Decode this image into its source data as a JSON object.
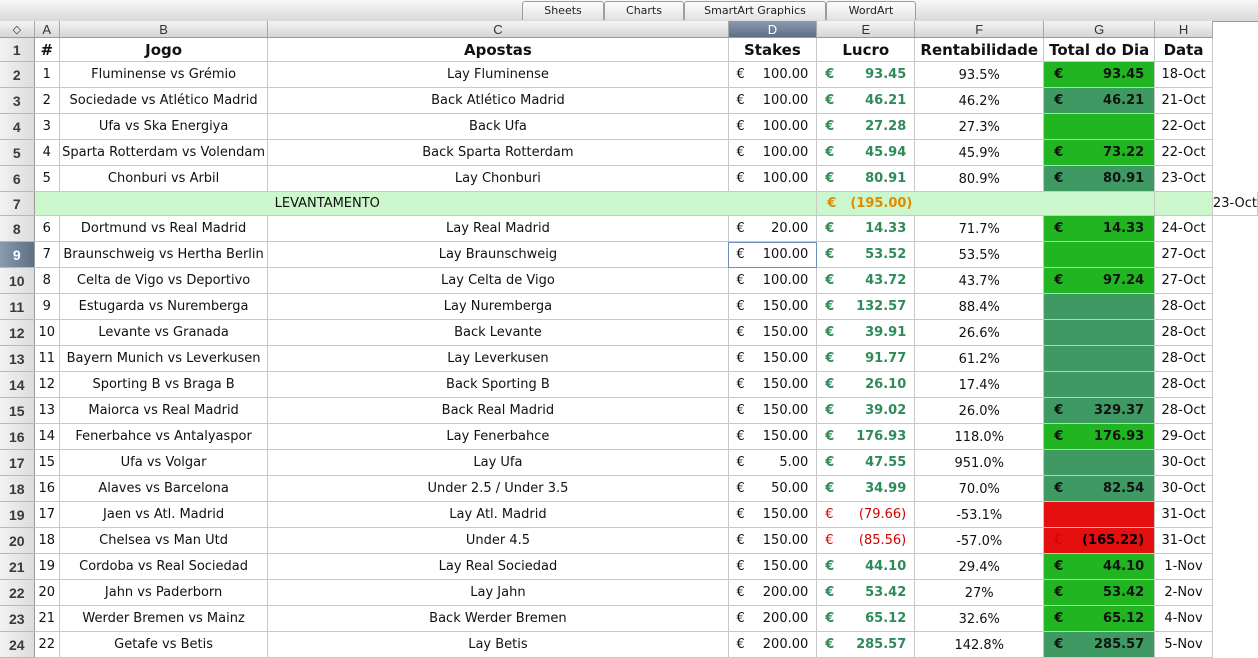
{
  "ribbon": {
    "tabs": [
      "Sheets",
      "Charts",
      "SmartArt Graphics",
      "WordArt"
    ]
  },
  "corner_glyph": "◇",
  "columns": [
    "A",
    "B",
    "C",
    "D",
    "E",
    "F",
    "G",
    "H"
  ],
  "selected_column": "D",
  "selected_row": 9,
  "currency": "€",
  "headers": {
    "num": "#",
    "jogo": "Jogo",
    "apostas": "Apostas",
    "stakes": "Stakes",
    "lucro": "Lucro",
    "rent": "Rentabilidade",
    "total": "Total do Dia",
    "data": "Data"
  },
  "levantamento": {
    "row": 7,
    "label": "LEVANTAMENTO",
    "value": "(195.00)",
    "date": "23-Oct"
  },
  "bets": [
    {
      "row": 2,
      "n": "1",
      "jogo": "Fluminense vs Grémio",
      "aposta": "Lay Fluminense",
      "stake": "100.00",
      "lucro": "93.45",
      "rent": "93.5%",
      "total": "93.45",
      "data": "18-Oct"
    },
    {
      "row": 3,
      "n": "2",
      "jogo": "Sociedade vs Atlético Madrid",
      "aposta": "Back Atlético Madrid",
      "stake": "100.00",
      "lucro": "46.21",
      "rent": "46.2%",
      "total": "46.21",
      "data": "21-Oct"
    },
    {
      "row": 4,
      "n": "3",
      "jogo": "Ufa vs Ska Energiya",
      "aposta": "Back Ufa",
      "stake": "100.00",
      "lucro": "27.28",
      "rent": "27.3%",
      "total": "",
      "data": "22-Oct"
    },
    {
      "row": 5,
      "n": "4",
      "jogo": "Sparta Rotterdam vs Volendam",
      "aposta": "Back Sparta Rotterdam",
      "stake": "100.00",
      "lucro": "45.94",
      "rent": "45.9%",
      "total": "73.22",
      "data": "22-Oct"
    },
    {
      "row": 6,
      "n": "5",
      "jogo": "Chonburi vs Arbil",
      "aposta": "Lay Chonburi",
      "stake": "100.00",
      "lucro": "80.91",
      "rent": "80.9%",
      "total": "80.91",
      "data": "23-Oct"
    },
    {
      "row": 8,
      "n": "6",
      "jogo": "Dortmund vs Real Madrid",
      "aposta": "Lay Real Madrid",
      "stake": "20.00",
      "lucro": "14.33",
      "rent": "71.7%",
      "total": "14.33",
      "data": "24-Oct"
    },
    {
      "row": 9,
      "n": "7",
      "jogo": "Braunschweig vs Hertha Berlin",
      "aposta": "Lay Braunschweig",
      "stake": "100.00",
      "lucro": "53.52",
      "rent": "53.5%",
      "total": "",
      "data": "27-Oct"
    },
    {
      "row": 10,
      "n": "8",
      "jogo": "Celta de Vigo vs Deportivo",
      "aposta": "Lay Celta de Vigo",
      "stake": "100.00",
      "lucro": "43.72",
      "rent": "43.7%",
      "total": "97.24",
      "data": "27-Oct"
    },
    {
      "row": 11,
      "n": "9",
      "jogo": "Estugarda vs Nuremberga",
      "aposta": "Lay Nuremberga",
      "stake": "150.00",
      "lucro": "132.57",
      "rent": "88.4%",
      "total": "",
      "data": "28-Oct"
    },
    {
      "row": 12,
      "n": "10",
      "jogo": "Levante vs Granada",
      "aposta": "Back Levante",
      "stake": "150.00",
      "lucro": "39.91",
      "rent": "26.6%",
      "total": "",
      "data": "28-Oct"
    },
    {
      "row": 13,
      "n": "11",
      "jogo": "Bayern Munich vs Leverkusen",
      "aposta": "Lay Leverkusen",
      "stake": "150.00",
      "lucro": "91.77",
      "rent": "61.2%",
      "total": "",
      "data": "28-Oct"
    },
    {
      "row": 14,
      "n": "12",
      "jogo": "Sporting B vs Braga B",
      "aposta": "Back Sporting B",
      "stake": "150.00",
      "lucro": "26.10",
      "rent": "17.4%",
      "total": "",
      "data": "28-Oct"
    },
    {
      "row": 15,
      "n": "13",
      "jogo": "Maiorca vs Real Madrid",
      "aposta": "Back Real Madrid",
      "stake": "150.00",
      "lucro": "39.02",
      "rent": "26.0%",
      "total": "329.37",
      "data": "28-Oct"
    },
    {
      "row": 16,
      "n": "14",
      "jogo": "Fenerbahce vs Antalyaspor",
      "aposta": "Lay Fenerbahce",
      "stake": "150.00",
      "lucro": "176.93",
      "rent": "118.0%",
      "total": "176.93",
      "data": "29-Oct"
    },
    {
      "row": 17,
      "n": "15",
      "jogo": "Ufa vs Volgar",
      "aposta": "Lay Ufa",
      "stake": "5.00",
      "lucro": "47.55",
      "rent": "951.0%",
      "total": "",
      "data": "30-Oct"
    },
    {
      "row": 18,
      "n": "16",
      "jogo": "Alaves vs Barcelona",
      "aposta": "Under 2.5 / Under 3.5",
      "stake": "50.00",
      "lucro": "34.99",
      "rent": "70.0%",
      "total": "82.54",
      "data": "30-Oct"
    },
    {
      "row": 19,
      "n": "17",
      "jogo": "Jaen vs Atl. Madrid",
      "aposta": "Lay Atl. Madrid",
      "stake": "150.00",
      "lucro": "(79.66)",
      "rent": "-53.1%",
      "total": "",
      "data": "31-Oct"
    },
    {
      "row": 20,
      "n": "18",
      "jogo": "Chelsea vs Man Utd",
      "aposta": "Under 4.5",
      "stake": "150.00",
      "lucro": "(85.56)",
      "rent": "-57.0%",
      "total": "(165.22)",
      "data": "31-Oct"
    },
    {
      "row": 21,
      "n": "19",
      "jogo": "Cordoba vs Real Sociedad",
      "aposta": "Lay Real Sociedad",
      "stake": "150.00",
      "lucro": "44.10",
      "rent": "29.4%",
      "total": "44.10",
      "data": "1-Nov"
    },
    {
      "row": 22,
      "n": "20",
      "jogo": "Jahn vs Paderborn",
      "aposta": "Lay Jahn",
      "stake": "200.00",
      "lucro": "53.42",
      "rent": "27%",
      "total": "53.42",
      "data": "2-Nov"
    },
    {
      "row": 23,
      "n": "21",
      "jogo": "Werder Bremen vs Mainz",
      "aposta": "Back Werder Bremen",
      "stake": "200.00",
      "lucro": "65.12",
      "rent": "32.6%",
      "total": "65.12",
      "data": "4-Nov"
    },
    {
      "row": 24,
      "n": "22",
      "jogo": "Getafe vs Betis",
      "aposta": "Lay Betis",
      "stake": "200.00",
      "lucro": "285.57",
      "rent": "142.8%",
      "total": "285.57",
      "data": "5-Nov"
    }
  ],
  "total_fill": {
    "2": "bright",
    "3": "dark",
    "4": "bright",
    "5": "bright",
    "6": "dark",
    "8": "bright",
    "9": "bright",
    "10": "bright",
    "11": "dark",
    "12": "dark",
    "13": "dark",
    "14": "dark",
    "15": "dark",
    "16": "bright",
    "17": "dark",
    "18": "dark",
    "19": "red",
    "20": "red",
    "21": "bright",
    "22": "bright",
    "23": "bright",
    "24": "dark"
  }
}
